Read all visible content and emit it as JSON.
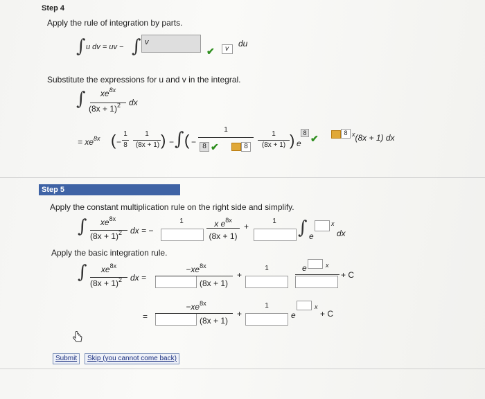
{
  "step4": {
    "heading": "Step 4",
    "instruction": "Apply the rule of integration by parts.",
    "parts_rule": "u dv = uv −",
    "v_entry": "v",
    "du_label": "du",
    "v_box_label": "v",
    "substitute_text": "Substitute the expressions for u and v in the integral.",
    "integrand_num": "xe",
    "integrand_exp": "8x",
    "integrand_den": "(8x + 1)",
    "integrand_den_pow": "2",
    "dx": "dx",
    "result_prefix": "= xe",
    "result_exp": "8x",
    "minus": "−",
    "one": "1",
    "eight": "8",
    "den_8x1": "(8x + 1)",
    "box_8a": "8",
    "box_8b": "8",
    "box_8c": "8",
    "box_8d": "8",
    "tail": "(8x + 1) dx"
  },
  "step5": {
    "heading": "Step 5",
    "instruction": "Apply the constant multiplication rule on the right side and simplify.",
    "line1_eq": "dx = −",
    "line1_frac1_num": "1",
    "line1_frac2_num": "x e",
    "line1_frac2_exp": "8x",
    "line1_frac2_den": "(8x + 1)",
    "line1_plus": "+",
    "line1_frac3_num": "1",
    "line1_e": "e",
    "line1_x": "x",
    "line1_dx": "dx",
    "basic_rule_text": "Apply the basic integration rule.",
    "line2_eq": "dx =",
    "line2_num": "−xe",
    "line2_exp": "8x",
    "line2_den": "(8x + 1)",
    "line2_plus": "+",
    "line2_one": "1",
    "line2_e": "e",
    "line2_x": "x",
    "line2_c": "+ C",
    "line3_eq": "=",
    "line3_num": "−xe",
    "line3_exp": "8x",
    "line3_den": "(8x + 1)",
    "line3_plus": "+",
    "line3_one": "1",
    "line3_e": "e",
    "line3_x": "x",
    "line3_c": "+ C"
  },
  "buttons": {
    "submit": "Submit",
    "skip": "Skip (you cannot come back)"
  }
}
